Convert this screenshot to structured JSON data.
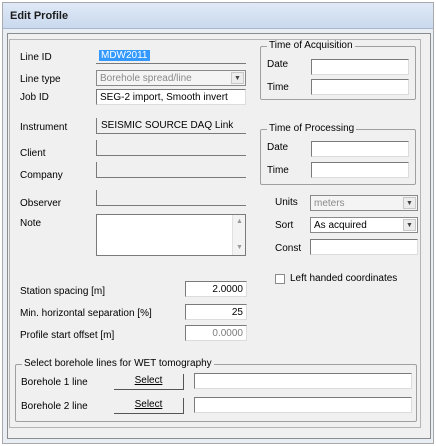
{
  "window": {
    "title": "Edit Profile"
  },
  "form": {
    "line_id": {
      "label": "Line ID",
      "value": "MDW2011"
    },
    "line_type": {
      "label": "Line type",
      "value": "Borehole spread/line"
    },
    "job_id": {
      "label": "Job ID",
      "value": "SEG-2 import, Smooth invert"
    },
    "instrument": {
      "label": "Instrument",
      "value": "SEISMIC SOURCE DAQ Link"
    },
    "client": {
      "label": "Client",
      "value": ""
    },
    "company": {
      "label": "Company",
      "value": ""
    },
    "observer": {
      "label": "Observer",
      "value": ""
    },
    "note": {
      "label": "Note",
      "value": ""
    }
  },
  "acquisition": {
    "legend": "Time of Acquisition",
    "date_label": "Date",
    "date_value": "",
    "time_label": "Time",
    "time_value": ""
  },
  "processing": {
    "legend": "Time of Processing",
    "date_label": "Date",
    "date_value": "",
    "time_label": "Time",
    "time_value": ""
  },
  "units": {
    "label": "Units",
    "value": "meters"
  },
  "sort": {
    "label": "Sort",
    "value": "As acquired"
  },
  "const": {
    "label": "Const",
    "value": ""
  },
  "left_handed": {
    "label": "Left handed coordinates",
    "checked": false
  },
  "spacing": {
    "station_label": "Station spacing [m]",
    "station_value": "2.0000",
    "min_sep_label": "Min. horizontal separation [%]",
    "min_sep_value": "25",
    "offset_label": "Profile start offset [m]",
    "offset_value": "0.0000"
  },
  "borehole": {
    "legend": "Select borehole lines for WET tomography",
    "line1_label": "Borehole 1 line",
    "line1_button": "Select",
    "line1_value": "",
    "line2_label": "Borehole 2 line",
    "line2_button": "Select",
    "line2_value": ""
  }
}
